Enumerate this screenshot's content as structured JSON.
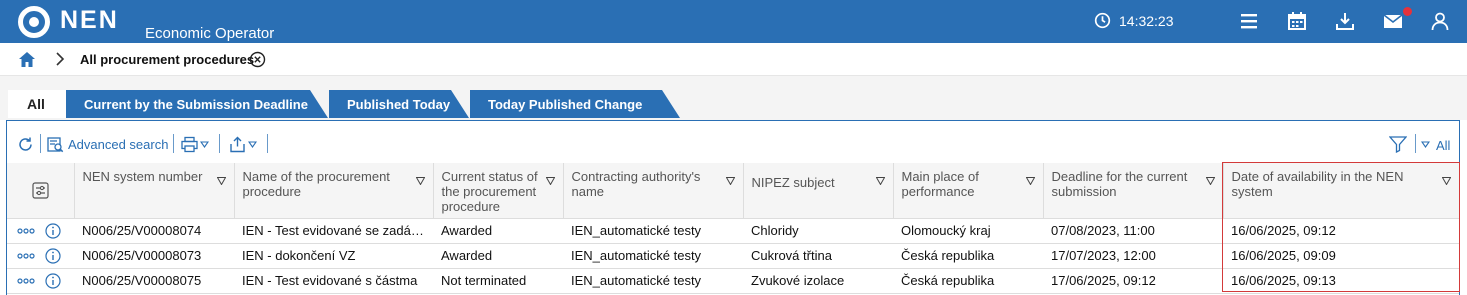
{
  "header": {
    "brand": "NEN",
    "subtitle": "Economic Operator",
    "time": "14:32:23",
    "icons": [
      "clock-icon",
      "menu-icon",
      "calendar-icon",
      "download-icon",
      "mail-icon",
      "user-icon"
    ],
    "accent_color": "#2a6fb4",
    "notification_color": "#e5323b"
  },
  "breadcrumb": {
    "current": "All procurement procedures"
  },
  "tabs": [
    {
      "label": "All",
      "active": true
    },
    {
      "label": "Current by the Submission Deadline",
      "active": false
    },
    {
      "label": "Published Today",
      "active": false
    },
    {
      "label": "Today Published Change",
      "active": false
    }
  ],
  "toolbar": {
    "advanced_search": "Advanced search",
    "filter_all": "All"
  },
  "table": {
    "columns": [
      "NEN system number",
      "Name of the procurement procedure",
      "Current status of the procurement procedure",
      "Contracting authority's name",
      "NIPEZ subject",
      "Main place of performance",
      "Deadline for the current submission",
      "Date of availability in the NEN system"
    ],
    "rows": [
      [
        "N006/25/V00008074",
        "IEN - Test evidované se zadávacím řízením",
        "Awarded",
        "IEN_automatické testy",
        "Chloridy",
        "Olomoucký kraj",
        "07/08/2023, 11:00",
        "16/06/2025, 09:12"
      ],
      [
        "N006/25/V00008073",
        "IEN - dokončení VZ",
        "Awarded",
        "IEN_automatické testy",
        "Cukrová třtina",
        "Česká republika",
        "17/07/2023, 12:00",
        "16/06/2025, 09:09"
      ],
      [
        "N006/25/V00008075",
        "IEN - Test evidované s částma",
        "Not terminated",
        "IEN_automatické testy",
        "Zvukové izolace",
        "Česká republika",
        "17/06/2025, 09:12",
        "16/06/2025, 09:13"
      ]
    ]
  }
}
